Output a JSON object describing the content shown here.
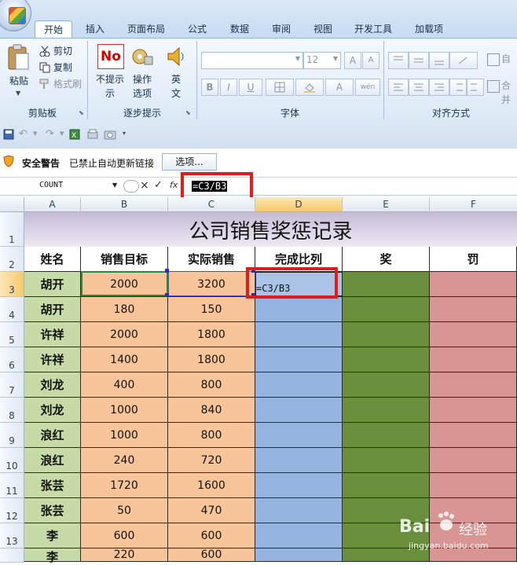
{
  "ribbon": {
    "tabs": [
      "开始",
      "插入",
      "页面布局",
      "公式",
      "数据",
      "审阅",
      "视图",
      "开发工具",
      "加载项"
    ],
    "clipboard": {
      "paste": "粘贴",
      "cut": "剪切",
      "copy": "复制",
      "format_painter": "格式刷",
      "label": "剪贴板"
    },
    "step_prompt": {
      "no_prompt": "不提示",
      "ops_line1": "操作",
      "ops_line2": "选项",
      "en": "英",
      "text_line2": "文",
      "label": "逐步提示",
      "no_badge": "No"
    },
    "font": {
      "name": "",
      "size": "12",
      "bold": "B",
      "italic": "I",
      "underline": "U",
      "grow": "A",
      "shrink": "A",
      "font_color": "A",
      "phonetic": "wén",
      "label": "字体"
    },
    "alignment": {
      "label": "对齐方式",
      "wrap_partial": "自",
      "merge_partial": "合并"
    }
  },
  "message_bar": {
    "title": "安全警告",
    "text": "已禁止自动更新链接",
    "options_button": "选项..."
  },
  "formula_bar": {
    "name_box": "COUNT",
    "fx": "fx",
    "formula": "=C3/B3"
  },
  "columns": [
    "A",
    "B",
    "C",
    "D",
    "E",
    "F"
  ],
  "rows": [
    "1",
    "2",
    "3",
    "4",
    "5",
    "6",
    "7",
    "8",
    "9",
    "10",
    "11",
    "12",
    "13",
    ""
  ],
  "sheet": {
    "title": "公司销售奖惩记录",
    "headers": [
      "姓名",
      "销售目标",
      "实际销售",
      "完成比列",
      "奖",
      "罚"
    ],
    "data": [
      {
        "name": "胡开",
        "target": "2000",
        "actual": "3200"
      },
      {
        "name": "胡开",
        "target": "180",
        "actual": "150"
      },
      {
        "name": "许祥",
        "target": "2000",
        "actual": "1800"
      },
      {
        "name": "许祥",
        "target": "1400",
        "actual": "1800"
      },
      {
        "name": "刘龙",
        "target": "400",
        "actual": "800"
      },
      {
        "name": "刘龙",
        "target": "1000",
        "actual": "840"
      },
      {
        "name": "浪红",
        "target": "1000",
        "actual": "800"
      },
      {
        "name": "浪红",
        "target": "240",
        "actual": "720"
      },
      {
        "name": "张芸",
        "target": "1720",
        "actual": "1600"
      },
      {
        "name": "张芸",
        "target": "50",
        "actual": "470"
      },
      {
        "name": "李",
        "target": "600",
        "actual": "600"
      },
      {
        "name": "李",
        "target": "220",
        "actual": "600"
      }
    ],
    "editing_cell": "=C3/B3"
  },
  "watermark": {
    "brand": "Bai",
    "brand2": "经验",
    "url": "jingyan.baidu.com"
  },
  "colors": {
    "name_col": "#c6dba7",
    "num_cols": "#f8c59a",
    "ratio_col": "#95b5e0",
    "reward_col": "#6a8f3c",
    "penalty_col": "#d99594",
    "highlight": "#e11c1c"
  }
}
